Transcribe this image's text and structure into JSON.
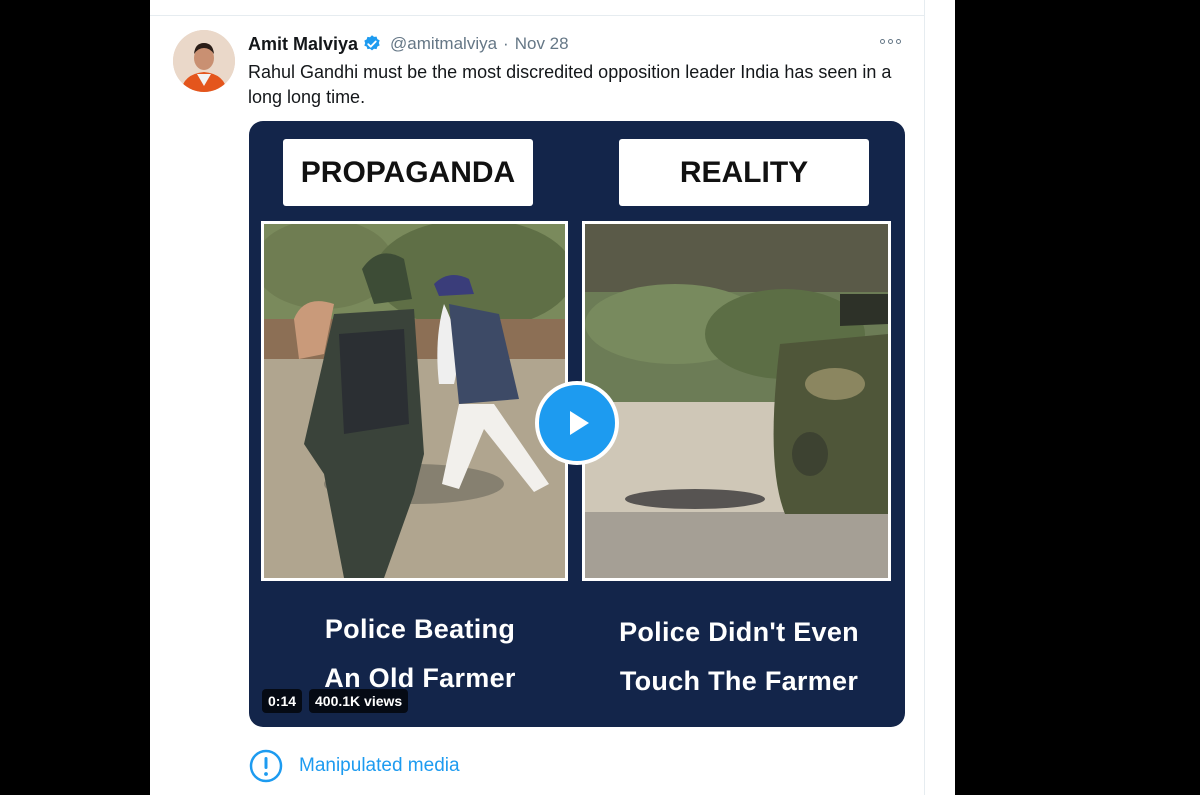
{
  "tweet": {
    "author_name": "Amit Malviya",
    "handle": "@amitmalviya",
    "separator": "·",
    "date": "Nov 28",
    "text": "Rahul Gandhi must be the most discredited opposition leader India has seen in a long long time."
  },
  "media": {
    "left_label": "PROPAGANDA",
    "right_label": "REALITY",
    "left_caption_line1": "Police Beating",
    "left_caption_line2": "An Old Farmer",
    "right_caption_line1": "Police Didn't Even",
    "right_caption_line2": "Touch The Farmer",
    "duration": "0:14",
    "views": "400.1K views",
    "background_color": "#13254a"
  },
  "notice": {
    "text": "Manipulated media",
    "icon": "exclamation-circle-icon"
  },
  "colors": {
    "accent": "#1d9bf0",
    "text_primary": "#14171a",
    "text_secondary": "#657786"
  }
}
